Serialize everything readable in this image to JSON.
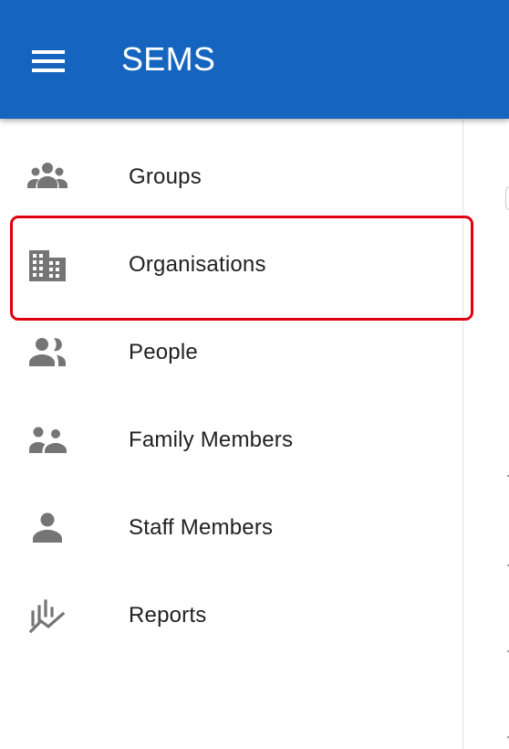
{
  "appbar": {
    "title": "SEMS",
    "background": "#1565c0",
    "menu_icon": "menu-icon"
  },
  "nav": {
    "items": [
      {
        "label": "Groups",
        "icon": "groups-icon"
      },
      {
        "label": "Organisations",
        "icon": "building-icon",
        "highlighted": true
      },
      {
        "label": "People",
        "icon": "people-icon"
      },
      {
        "label": "Family Members",
        "icon": "family-icon"
      },
      {
        "label": "Staff Members",
        "icon": "person-icon"
      },
      {
        "label": "Reports",
        "icon": "reports-icon"
      }
    ]
  },
  "colors": {
    "accent": "#1565c0",
    "highlight_border": "#e0000f",
    "icon": "#757575",
    "text": "#212121"
  }
}
